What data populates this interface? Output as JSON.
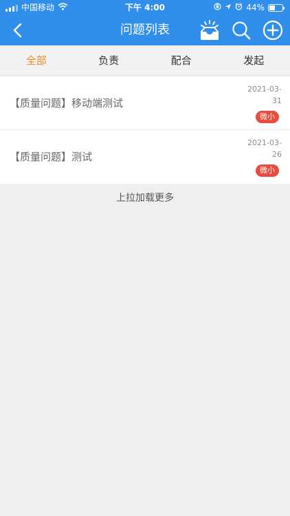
{
  "status_bar": {
    "carrier": "中国移动",
    "time": "下午 4:00",
    "battery": "44%"
  },
  "nav": {
    "title": "问题列表",
    "icons": [
      "back-icon",
      "inbox-icon",
      "search-icon",
      "add-circle-icon"
    ]
  },
  "tabs": [
    {
      "label": "全部",
      "active": true
    },
    {
      "label": "负责",
      "active": false
    },
    {
      "label": "配合",
      "active": false
    },
    {
      "label": "发起",
      "active": false
    }
  ],
  "issues": [
    {
      "title": "【质量问题】移动端测试",
      "date": "2021-03-31",
      "badge": "微小"
    },
    {
      "title": "【质量问题】测试",
      "date": "2021-03-26",
      "badge": "微小"
    }
  ],
  "load_more": "上拉加载更多",
  "colors": {
    "header_bg": "#2f8fea",
    "active_tab": "#f08a24",
    "badge_bg": "#e94b3c"
  }
}
